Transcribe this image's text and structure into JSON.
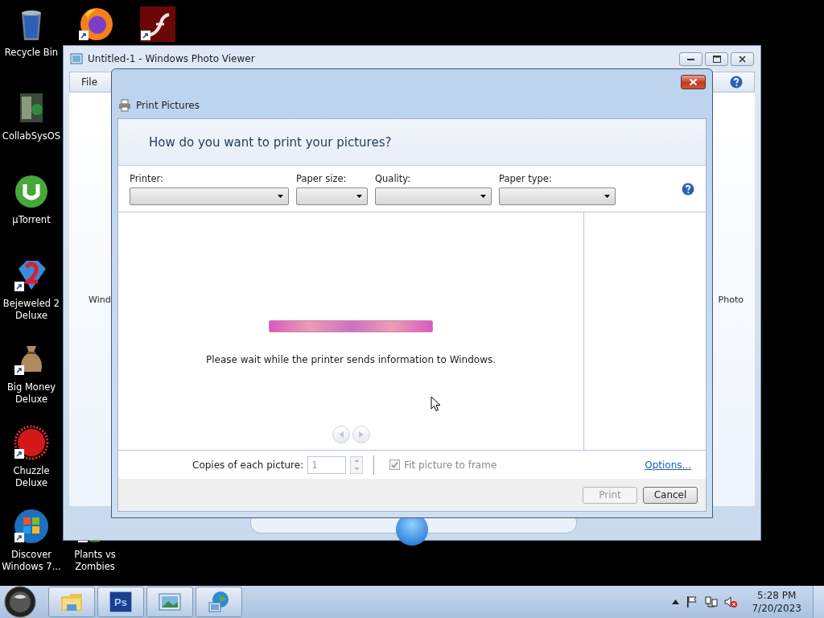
{
  "desktop_icons": [
    {
      "label": "Recycle Bin",
      "kind": "recycle",
      "shortcut": false
    },
    {
      "label": "CollabSysOS",
      "kind": "collab",
      "shortcut": false
    },
    {
      "label": "µTorrent",
      "kind": "torrent",
      "shortcut": false
    },
    {
      "label": "Bejeweled 2 Deluxe",
      "kind": "gem",
      "shortcut": true
    },
    {
      "label": "Big Money Deluxe",
      "kind": "money",
      "shortcut": true
    },
    {
      "label": "Chuzzle Deluxe",
      "kind": "fuzzball",
      "shortcut": true
    },
    {
      "label": "Discover Windows 7...",
      "kind": "windows",
      "shortcut": true
    },
    {
      "kind": "firefox",
      "shortcut": true
    },
    {
      "kind": "flash",
      "shortcut": true
    },
    {
      "label": "Plants vs Zombies",
      "kind": "plant",
      "shortcut": true
    }
  ],
  "photo_viewer": {
    "title": "Untitled-1 - Windows Photo Viewer",
    "menu": [
      "File"
    ],
    "background_texts": [
      "Wind",
      "Photo"
    ]
  },
  "dialog": {
    "title": "Print Pictures",
    "heading": "How do you want to print your pictures?",
    "fields": [
      {
        "label": "Printer:"
      },
      {
        "label": "Paper size:"
      },
      {
        "label": "Quality:"
      },
      {
        "label": "Paper type:"
      }
    ],
    "progress": {
      "level": 1
    },
    "progress_message": "Please wait while the printer sends information to Windows.",
    "nav_buttons": [
      {
        "kind": "previous",
        "disabled": true
      },
      {
        "kind": "next",
        "disabled": true
      }
    ],
    "copies": {
      "label": "Copies of each picture:",
      "value": "1",
      "disabled": true
    },
    "fit": {
      "label": "Fit picture to frame",
      "checked": true,
      "disabled": true
    },
    "options_link": "Options...",
    "buttons": [
      {
        "label": "Print",
        "disabled": true
      },
      {
        "label": "Cancel",
        "disabled": false
      }
    ]
  },
  "taskbar": {
    "apps": [
      {
        "kind": "folder"
      },
      {
        "kind": "photoshop",
        "label": "Ps"
      },
      {
        "kind": "photo"
      },
      {
        "kind": "globe"
      }
    ],
    "clock": {
      "time": "5:28 PM",
      "date": "7/20/2023"
    }
  }
}
